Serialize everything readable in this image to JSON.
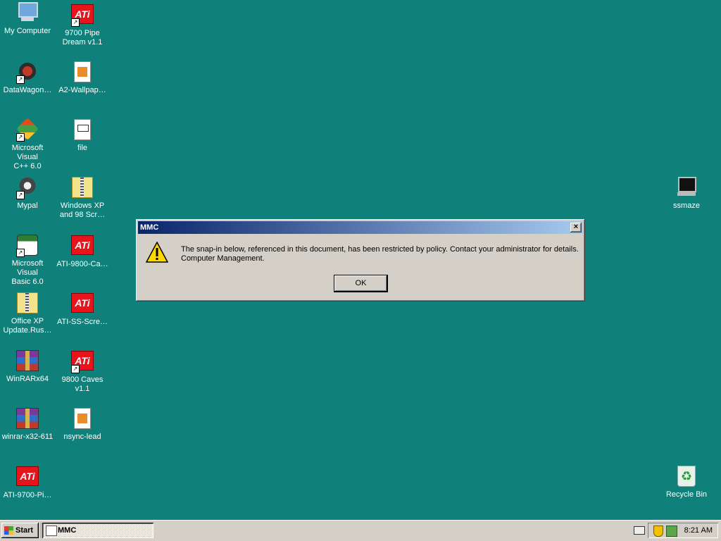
{
  "desktop": {
    "icons": [
      {
        "label": "My Computer"
      },
      {
        "label": "9700 Pipe\nDream v1.1"
      },
      {
        "label": "DataWagon…"
      },
      {
        "label": "A2-Wallpap…"
      },
      {
        "label": "Microsoft Visual\nC++ 6.0"
      },
      {
        "label": "file"
      },
      {
        "label": "Mypal"
      },
      {
        "label": "Windows XP\nand 98 Scr…"
      },
      {
        "label": "Microsoft Visual\nBasic 6.0"
      },
      {
        "label": "ATI-9800-Ca…"
      },
      {
        "label": "Office XP\nUpdate.Rus…"
      },
      {
        "label": "ATI-SS-Scre…"
      },
      {
        "label": "WinRARx64"
      },
      {
        "label": "9800 Caves\nv1.1"
      },
      {
        "label": "winrar-x32-611"
      },
      {
        "label": "nsync-lead"
      },
      {
        "label": "ATI-9700-Pi…"
      },
      {
        "label": "ssmaze"
      },
      {
        "label": "Recycle Bin"
      }
    ],
    "ati_logo_text": "ATi",
    "background_color": "#0f807a"
  },
  "dialog": {
    "title": "MMC",
    "close_label": "×",
    "message_line1": "The snap-in below, referenced in this document, has been restricted by policy. Contact your administrator for details.",
    "message_line2": "Computer Management.",
    "ok_label": "OK",
    "icon": "warning-icon"
  },
  "taskbar": {
    "start_label": "Start",
    "tasks": [
      {
        "label": "MMC"
      }
    ],
    "clock": "8:21 AM"
  }
}
